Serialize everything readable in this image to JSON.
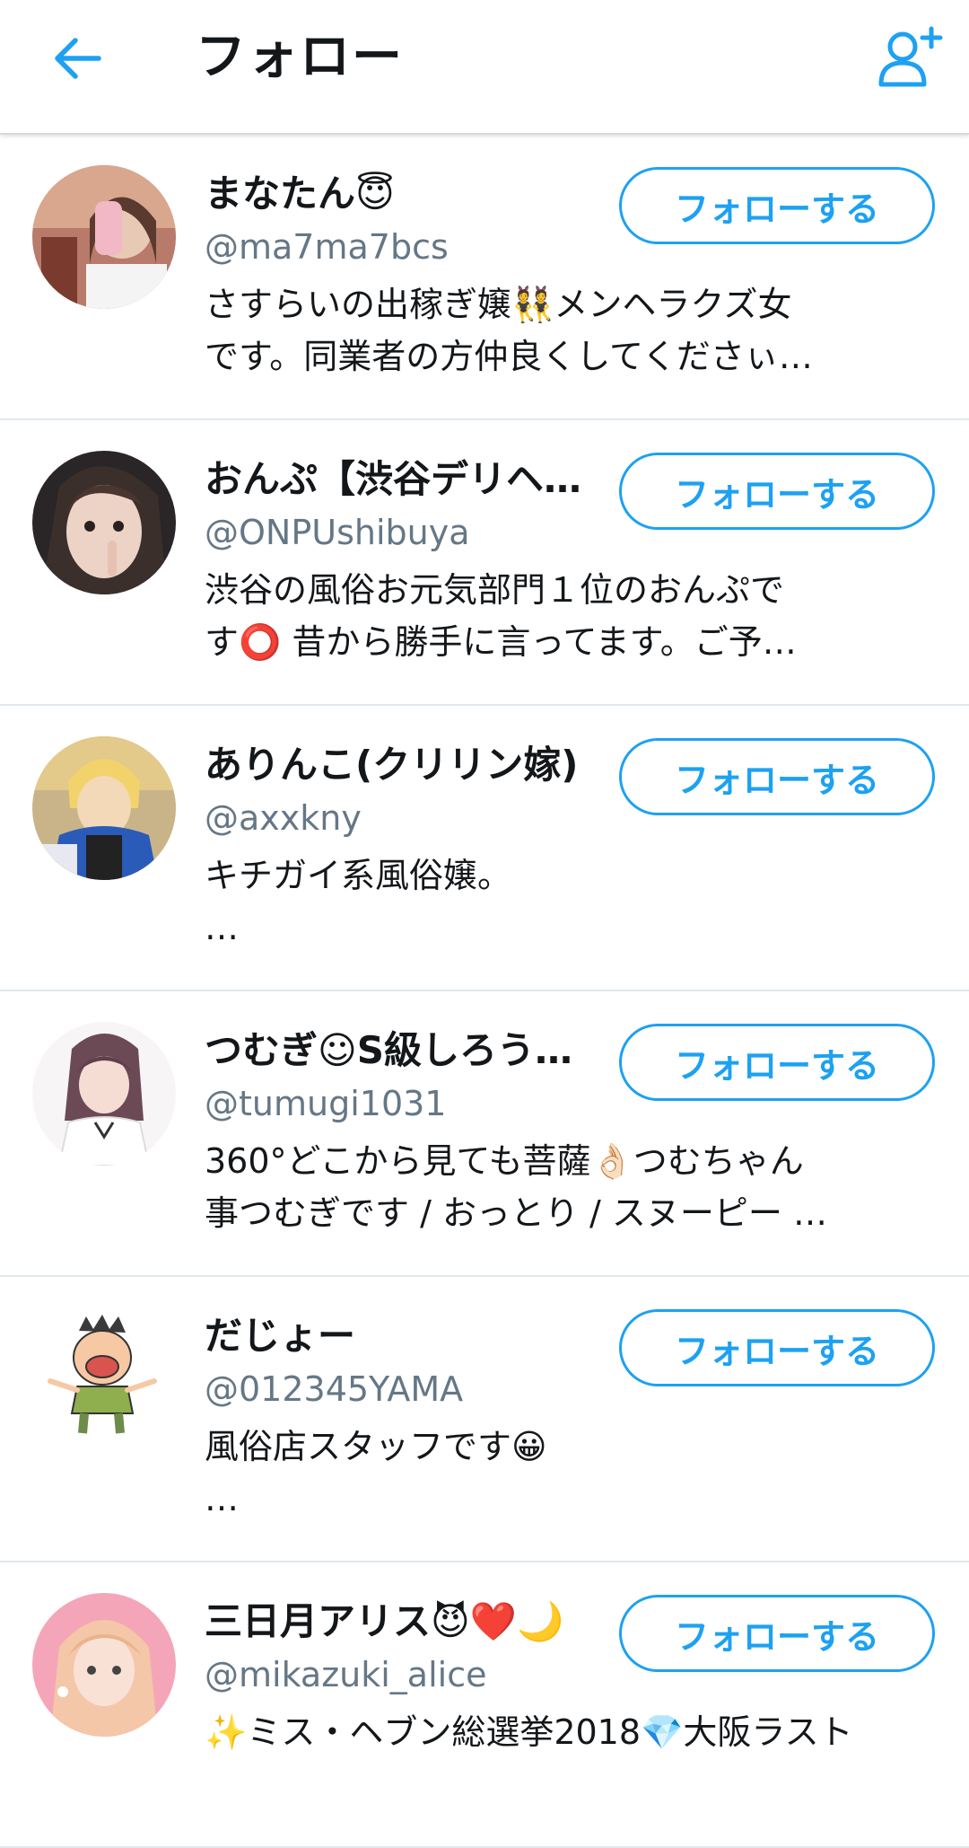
{
  "header": {
    "title": "フォロー",
    "back_icon": "arrow-left-icon",
    "add_icon": "add-user-icon",
    "accent_color": "#1da1f2"
  },
  "users": [
    {
      "name": "まなたん😇",
      "handle": "@ma7ma7bcs",
      "bio_lines": [
        "さすらいの出稼ぎ嬢👯メンヘラクズ女",
        "です。同業者の方仲良くしてくださぃ…"
      ],
      "button": "フォローする"
    },
    {
      "name": "おんぷ【渋谷デリヘ…",
      "handle": "@ONPUshibuya",
      "bio_lines": [
        "渋谷の風俗お元気部門１位のおんぷで",
        "す⭕ 昔から勝手に言ってます。ご予…"
      ],
      "button": "フォローする"
    },
    {
      "name": "ありんこ(クリリン嫁)",
      "handle": "@axxkny",
      "bio_lines": [
        "キチガイ系風俗嬢。",
        "…"
      ],
      "button": "フォローする"
    },
    {
      "name": "つむぎ☺S級しろうと…",
      "handle": "@tumugi1031",
      "bio_lines": [
        "360°どこから見ても菩薩👌🏻つむちゃん",
        "事つむぎです / おっとり / スヌーピー …"
      ],
      "button": "フォローする"
    },
    {
      "name": "だじょー",
      "handle": "@012345YAMA",
      "bio_lines": [
        "風俗店スタッフです😀",
        "…"
      ],
      "button": "フォローする"
    },
    {
      "name": "三日月アリス😈❤️🌙",
      "handle": "@mikazuki_alice",
      "bio_lines": [
        "✨ミス・ヘブン総選挙2018💎大阪ラスト"
      ],
      "button": "フォローする"
    }
  ]
}
